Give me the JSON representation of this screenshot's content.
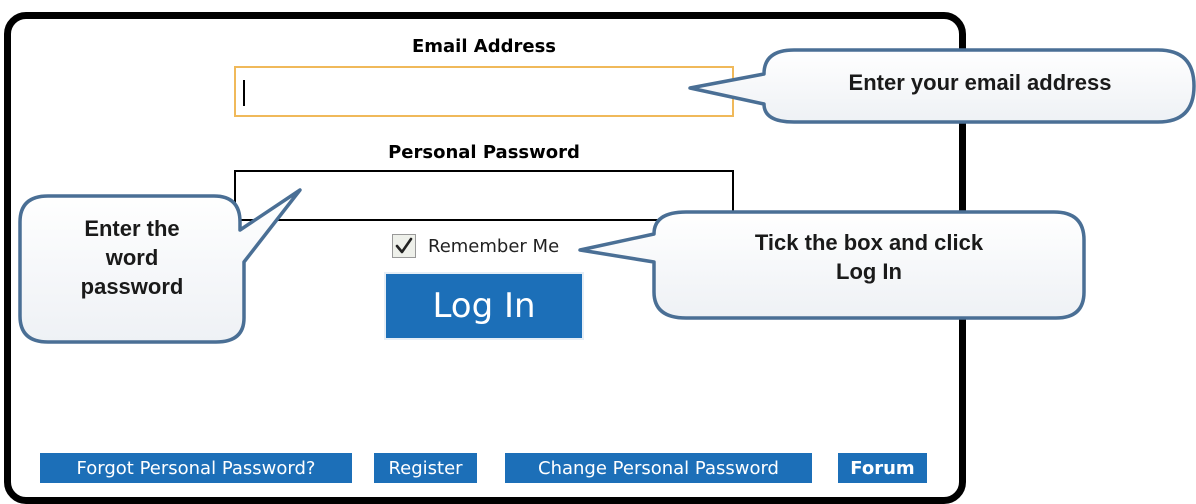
{
  "form": {
    "email_label": "Email Address",
    "email_value": "",
    "password_label": "Personal Password",
    "password_value": "",
    "remember_label": "Remember Me",
    "remember_checked": true,
    "login_label": "Log In"
  },
  "footer_links": {
    "forgot": "Forgot Personal Password?",
    "register": "Register",
    "change": "Change Personal Password",
    "forum": "Forum"
  },
  "callouts": {
    "email": "Enter your email address",
    "password_line1": "Enter the",
    "password_line2": "word",
    "password_line3": "password",
    "login_line1": "Tick the box and click",
    "login_line2": "Log In"
  },
  "colors": {
    "button_blue": "#1c6fb8",
    "email_field_border": "#f0b95a",
    "callout_border": "#4a6f95"
  },
  "icons": {
    "checkbox": "checkmark-icon"
  }
}
